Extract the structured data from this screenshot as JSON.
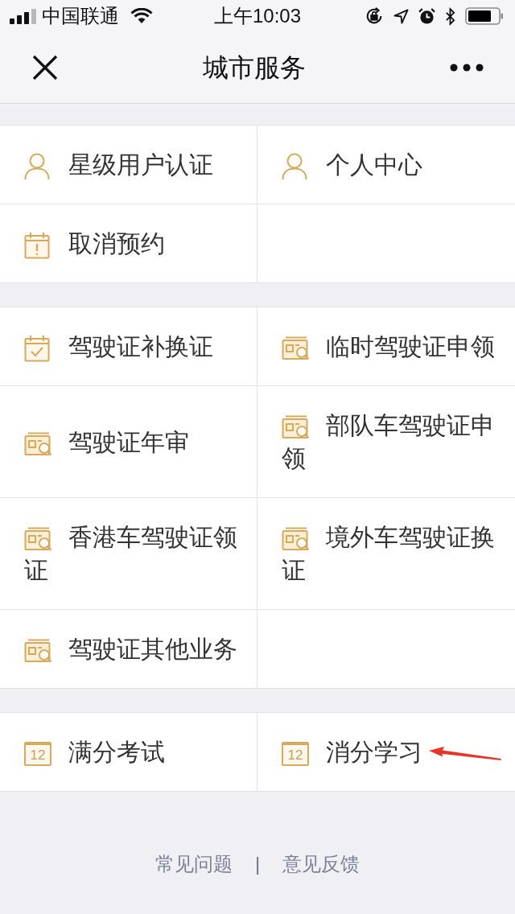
{
  "status_bar": {
    "carrier": "中国联通",
    "time": "上午10:03"
  },
  "nav_bar": {
    "title": "城市服务"
  },
  "sections": [
    {
      "items": [
        {
          "label": "星级用户认证",
          "kind": "person",
          "annotated": false
        },
        {
          "label": "个人中心",
          "kind": "person",
          "annotated": false
        },
        {
          "label": "取消预约",
          "kind": "calendar_alert",
          "annotated": false
        }
      ]
    },
    {
      "items": [
        {
          "label": "驾驶证补换证",
          "kind": "calendar_check",
          "annotated": false
        },
        {
          "label": "临时驾驶证申领",
          "kind": "license",
          "annotated": false
        },
        {
          "label": "驾驶证年审",
          "kind": "license",
          "annotated": false
        },
        {
          "label": "部队车驾驶证申领",
          "kind": "license",
          "annotated": false
        },
        {
          "label": "香港车驾驶证领证",
          "kind": "license",
          "annotated": false
        },
        {
          "label": "境外车驾驶证换证",
          "kind": "license",
          "annotated": false
        },
        {
          "label": "驾驶证其他业务",
          "kind": "license",
          "annotated": false
        }
      ]
    },
    {
      "items": [
        {
          "label": "满分考试",
          "kind": "calendar_date",
          "icon_text": "12",
          "annotated": false
        },
        {
          "label": "消分学习",
          "kind": "calendar_date",
          "icon_text": "12",
          "annotated": true
        }
      ]
    }
  ],
  "footer": {
    "links": [
      "常见问题",
      "意见反馈"
    ],
    "separator": "|"
  }
}
